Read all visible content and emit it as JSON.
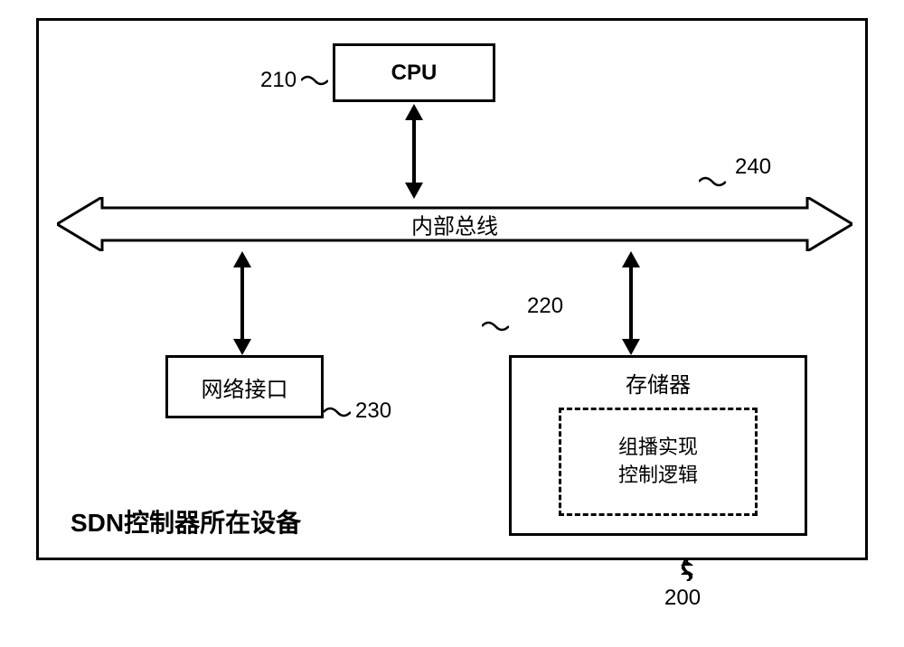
{
  "container": {
    "sdn_label": "SDN控制器所在设备",
    "ref_200": "200"
  },
  "cpu": {
    "label": "CPU",
    "ref": "210"
  },
  "bus": {
    "label": "内部总线",
    "ref": "240"
  },
  "network": {
    "label": "网络接口",
    "ref": "230"
  },
  "memory": {
    "label": "存储器",
    "ref": "220",
    "logic": "组播实现\n控制逻辑"
  }
}
